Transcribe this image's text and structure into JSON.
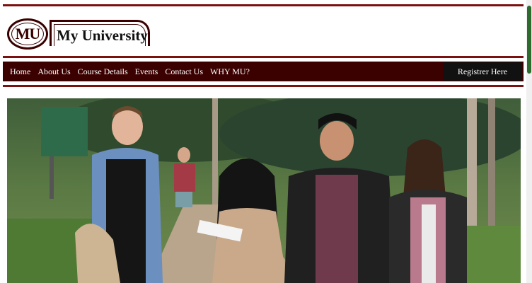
{
  "brand": {
    "logo_initials": "MU",
    "title": "My University"
  },
  "nav": {
    "items": [
      {
        "label": "Home"
      },
      {
        "label": "About Us"
      },
      {
        "label": "Course Details"
      },
      {
        "label": "Events"
      },
      {
        "label": "Contact Us"
      },
      {
        "label": "WHY MU?"
      }
    ],
    "register_label": "Registrer Here"
  },
  "colors": {
    "accent": "#7b1010",
    "nav_bg": "#3b0000",
    "register_bg": "#111111"
  }
}
